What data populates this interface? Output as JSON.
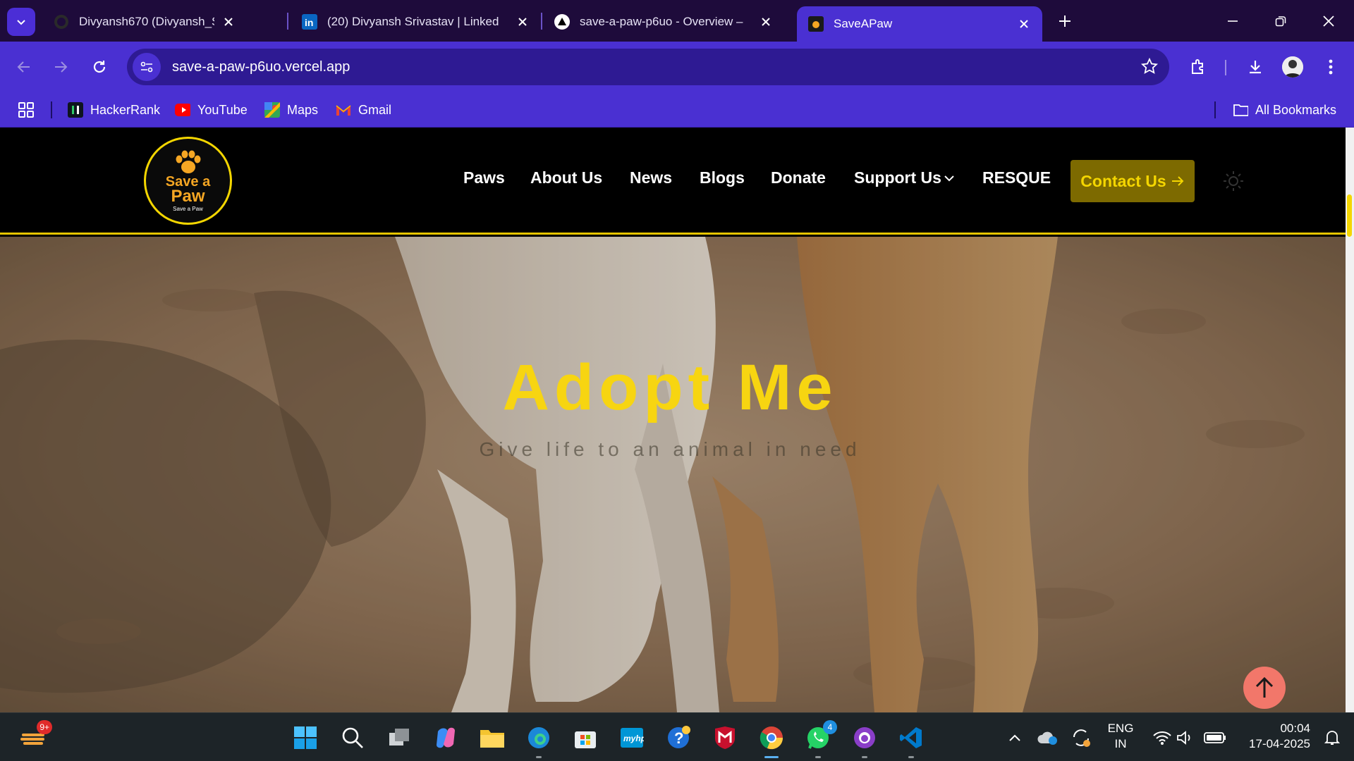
{
  "browser": {
    "tabs": [
      {
        "title": "Divyansh670 (Divyansh_Srivasta",
        "icon": "github-icon"
      },
      {
        "title": "(20) Divyansh Srivastav | Linked",
        "icon": "linkedin-icon"
      },
      {
        "title": "save-a-paw-p6uo - Overview – ",
        "icon": "vercel-icon"
      },
      {
        "title": "SaveAPaw",
        "icon": "saveapaw-favicon",
        "active": true
      }
    ],
    "url": "save-a-paw-p6uo.vercel.app",
    "bookmarks": [
      {
        "label": "HackerRank",
        "icon": "hackerrank-icon"
      },
      {
        "label": "YouTube",
        "icon": "youtube-icon"
      },
      {
        "label": "Maps",
        "icon": "maps-icon"
      },
      {
        "label": "Gmail",
        "icon": "gmail-icon"
      }
    ],
    "all_bookmarks_label": "All Bookmarks"
  },
  "site": {
    "logo": {
      "line1": "Save a",
      "line2": "Paw",
      "line3": "Save a Paw"
    },
    "menu": [
      "Paws",
      "About Us",
      "News",
      "Blogs",
      "Donate",
      "Support Us",
      "RESQUE"
    ],
    "cta_label": "Contact Us",
    "accent_color": "#f7d511"
  },
  "hero": {
    "title": "Adopt Me",
    "subtitle": "Give life to an animal in need"
  },
  "taskbar": {
    "widgets_badge": "9+",
    "whatsapp_badge": "4",
    "lang_line1": "ENG",
    "lang_line2": "IN",
    "time": "00:04",
    "date": "17-04-2025"
  }
}
